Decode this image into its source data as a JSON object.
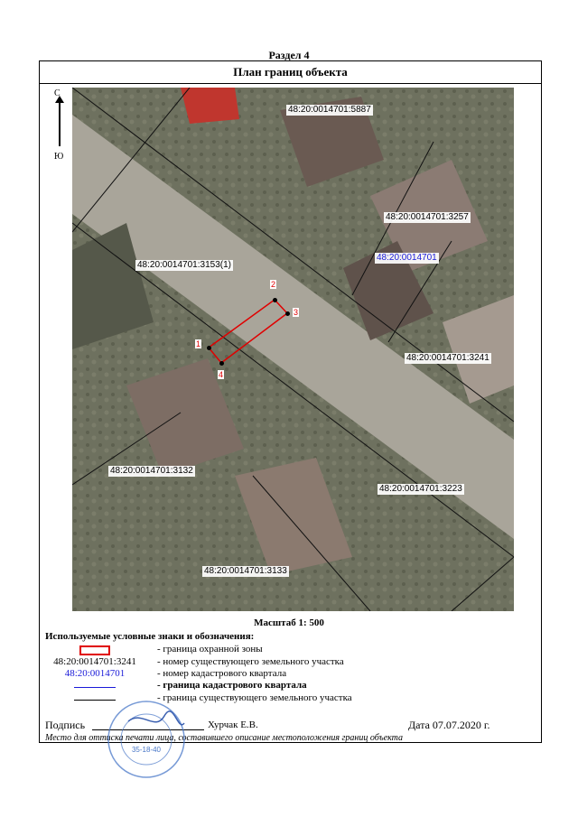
{
  "section": "Раздел 4",
  "title": "План границ объекта",
  "compass": {
    "north": "С",
    "south": "Ю"
  },
  "map": {
    "parcels": [
      "48:20:0014701:5887",
      "48:20:0014701:3257",
      "48:20:0014701:3153(1)",
      "48:20:0014701:3241",
      "48:20:0014701:3132",
      "48:20:0014701:3223",
      "48:20:0014701:3133"
    ],
    "quarter": "48:20:0014701",
    "points": [
      "1",
      "2",
      "3",
      "4"
    ],
    "zone_color": "#e00000",
    "quarter_color": "#1a1ad8"
  },
  "scale": "Масштаб 1: 500",
  "legend": {
    "title": "Используемые условные знаки и обозначения:",
    "items": [
      {
        "symbol": "",
        "text": "- граница  охранной зоны"
      },
      {
        "symbol": "48:20:0014701:3241",
        "text": "- номер существующего земельного участка"
      },
      {
        "symbol": "48:20:0014701",
        "text": "- номер кадастрового квартала"
      },
      {
        "symbol": "",
        "text": "- граница кадастрового квартала"
      },
      {
        "symbol": "",
        "text": "- граница существующего земельного участка"
      }
    ]
  },
  "signature": {
    "label": "Подпись",
    "name": "Хурчак Е.В.",
    "date": "Дата 07.07.2020 г.",
    "note": "Место для оттиска печати лица, составившего описание местоположения границ объекта"
  },
  "stamp": {
    "text": "35-18-40"
  }
}
